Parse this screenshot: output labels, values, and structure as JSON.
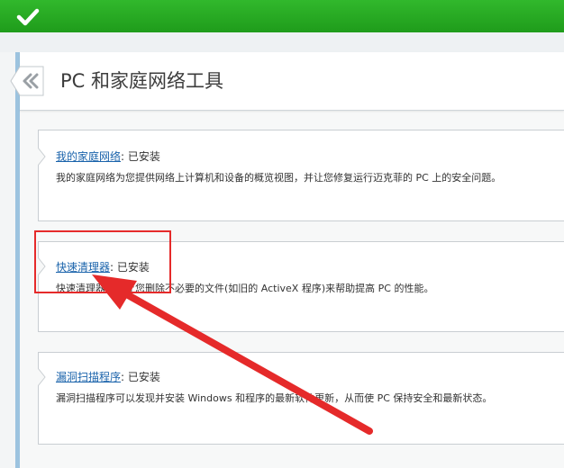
{
  "header": {
    "title": "PC 和家庭网络工具",
    "back_icon": "double-chevron-left-icon",
    "status_icon": "checkmark-icon"
  },
  "tools": [
    {
      "name": "我的家庭网络",
      "separator": ": ",
      "status": "已安装",
      "description": "我的家庭网络为您提供网络上计算机和设备的概览视图，并让您修复运行迈克菲的 PC 上的安全问题。"
    },
    {
      "name": "快速清理器",
      "separator": ": ",
      "status": "已安装",
      "description": "快速清理器通过让您删除不必要的文件(如旧的 ActiveX 程序)来帮助提高 PC 的性能。"
    },
    {
      "name": "漏洞扫描程序",
      "separator": ": ",
      "status": "已安装",
      "description": "漏洞扫描程序可以发现并安装 Windows 和程序的最新软件更新，从而使 PC 保持安全和最新状态。"
    }
  ],
  "colors": {
    "topbar": "#2aa827",
    "link": "#1a63ab",
    "annotation": "#e52a2a",
    "panel_accent": "#9cc3df"
  }
}
